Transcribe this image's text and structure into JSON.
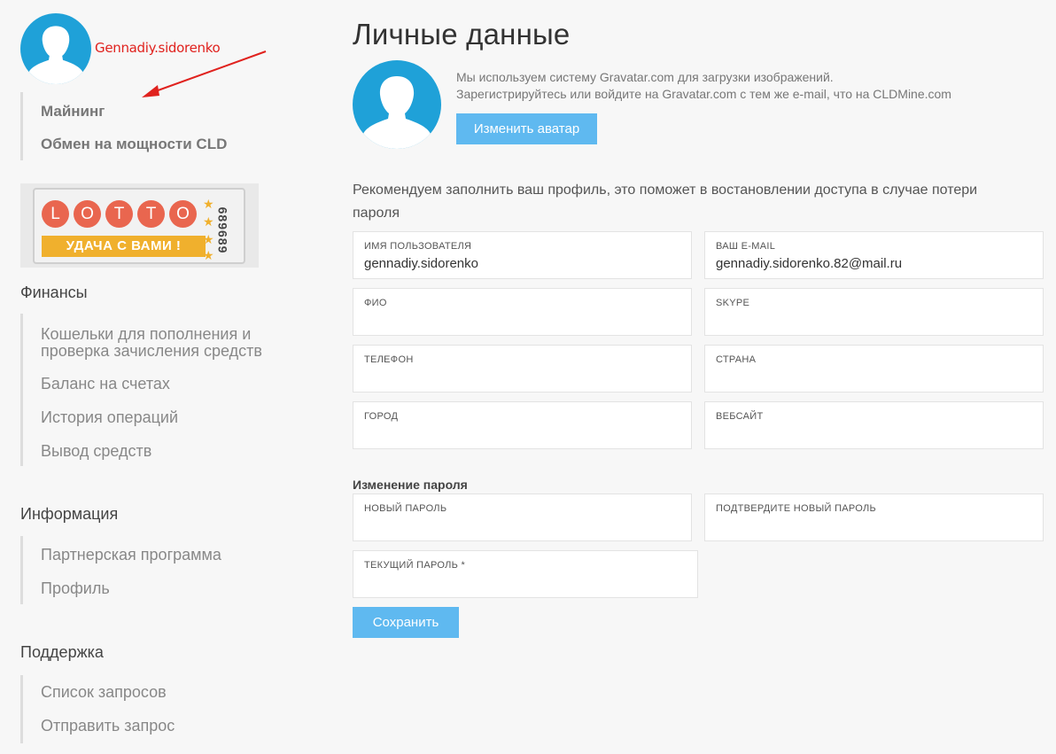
{
  "user": {
    "username": "Gennadiy.sidorenko"
  },
  "sidebar": {
    "main_items": [
      "Майнинг",
      "Обмен на мощности CLD"
    ],
    "lotto": {
      "letters": [
        "L",
        "O",
        "T",
        "T",
        "O"
      ],
      "ribbon": "УДАЧА С ВАМИ !",
      "number": "689689"
    },
    "sections": [
      {
        "title": "Финансы",
        "items": [
          "Кошельки для пополнения и проверка зачисления средств",
          "Баланс на счетах",
          "История операций",
          "Вывод средств"
        ]
      },
      {
        "title": "Информация",
        "items": [
          "Партнерская программа",
          "Профиль"
        ]
      },
      {
        "title": "Поддержка",
        "items": [
          "Список запросов",
          "Отправить запрос"
        ]
      }
    ]
  },
  "main": {
    "title": "Личные данные",
    "gravatar_line1": "Мы используем систему Gravatar.com для загрузки изображений.",
    "gravatar_line2": "Зарегистрируйтесь или войдите на Gravatar.com с тем же e-mail, что на CLDMine.com",
    "change_avatar": "Изменить аватар",
    "recommend": "Рекомендуем заполнить ваш профиль, это поможет в востановлении доступа в случае потери пароля",
    "fields": {
      "username": {
        "label": "Имя пользователя",
        "value": "gennadiy.sidorenko"
      },
      "email": {
        "label": "Ваш E-mail",
        "value": "gennadiy.sidorenko.82@mail.ru"
      },
      "fio": {
        "label": "ФИО",
        "value": ""
      },
      "skype": {
        "label": "Skype",
        "value": ""
      },
      "phone": {
        "label": "Телефон",
        "value": ""
      },
      "country": {
        "label": "Страна",
        "value": ""
      },
      "city": {
        "label": "Город",
        "value": ""
      },
      "website": {
        "label": "Вебсайт",
        "value": ""
      },
      "new_password": {
        "label": "Новый пароль",
        "value": ""
      },
      "confirm_password": {
        "label": "Подтвердите новый пароль",
        "value": ""
      },
      "current_password": {
        "label": "Текущий пароль *",
        "value": ""
      }
    },
    "password_title": "Изменение пароля",
    "save": "Сохранить"
  },
  "colors": {
    "accent": "#5fb9f0",
    "avatar": "#1fa1d8",
    "username": "#e0221e",
    "lotto_ball": "#e9664f",
    "lotto_ribbon": "#f0b02d"
  }
}
